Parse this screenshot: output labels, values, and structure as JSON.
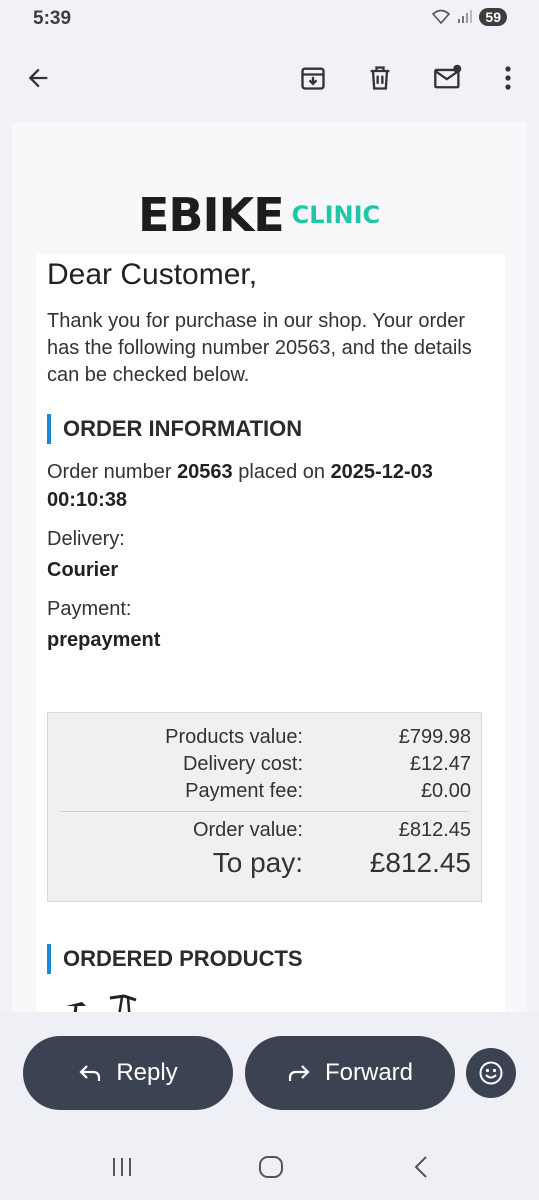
{
  "status": {
    "time": "5:39",
    "battery": "59"
  },
  "email": {
    "logo_main": "EBIKE",
    "logo_sub": "CLINIC",
    "greeting": "Dear Customer,",
    "intro": "Thank you for purchase in our shop. Your order has the following number 20563, and the details can be checked below.",
    "order_section_title": "ORDER INFORMATION",
    "order_prefix": "Order number",
    "order_number": "20563",
    "placed_on": "placed on",
    "order_date": "2025-12-03",
    "order_time": "00:10:38",
    "delivery_label": "Delivery:",
    "delivery_value": "Courier",
    "payment_label": "Payment:",
    "payment_value": "prepayment",
    "summary": {
      "products_label": "Products value:",
      "products_value": "£799.98",
      "delivery_label": "Delivery cost:",
      "delivery_value": "£12.47",
      "fee_label": "Payment fee:",
      "fee_value": "£0.00",
      "order_label": "Order value:",
      "order_value": "£812.45",
      "topay_label": "To pay:",
      "topay_value": "£812.45"
    },
    "products_section_title": "ORDERED PRODUCTS"
  },
  "actions": {
    "reply": "Reply",
    "forward": "Forward"
  },
  "icons": [
    "back-arrow-icon",
    "archive-icon",
    "trash-icon",
    "mark-unread-icon",
    "more-vert-icon",
    "reply-icon",
    "forward-icon",
    "emoji-icon"
  ]
}
